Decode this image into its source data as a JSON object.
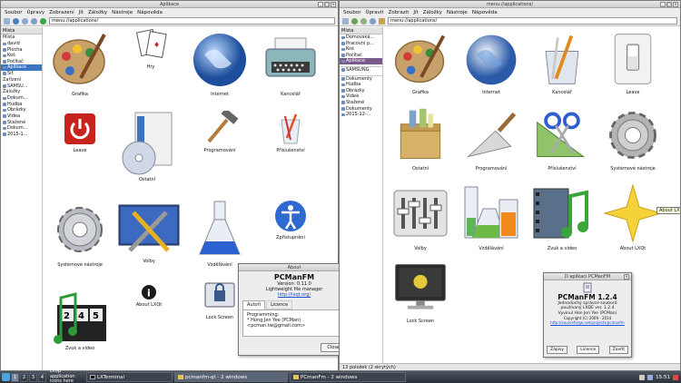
{
  "left_window": {
    "title": "Aplikace",
    "menu": [
      "Soubor",
      "Úpravy",
      "Zobrazení",
      "Jít",
      "Záložky",
      "Nástroje",
      "Nápověda"
    ],
    "address": "menu://applications/",
    "sidebar": {
      "header": "Místa",
      "group_places": "Místa",
      "places": [
        "david",
        "Plocha",
        "Koš",
        "Počítač",
        "Aplikace",
        "Síť"
      ],
      "group_devices": "Zařízení",
      "devices": [
        "SAMSU..."
      ],
      "group_bookmarks": "Záložky",
      "bookmarks": [
        "Dokum...",
        "Hudba",
        "Obrázky",
        "Videa",
        "Stažené",
        "Dokum...",
        "2015-1..."
      ]
    },
    "icons": [
      "Grafika",
      "Hry",
      "Internet",
      "Kancelář",
      "Leave",
      "Ostatní",
      "Programování",
      "Příslušenství",
      "Systémové nástroje",
      "Volby",
      "Vzdělávání",
      "Zpřístupnění",
      "Zvuk a video",
      "About LXQt",
      "Lock Screen"
    ]
  },
  "right_window": {
    "title": "menu://applications/",
    "menu": [
      "Soubor",
      "Úpravit",
      "Zobrazit",
      "Jít",
      "Záložky",
      "Nástroje",
      "Nápověda"
    ],
    "address": "menu://applications/",
    "sidebar": {
      "header": "Místa",
      "items": [
        "Domovská...",
        "Pracovní p...",
        "Koš",
        "Počítač",
        "Aplikace",
        "SAMSUNG",
        "Dokumenty",
        "Hudba",
        "Obrázky",
        "Videa",
        "Stažené",
        "Dokumenty",
        "2015-12-..."
      ]
    },
    "icons": [
      "Grafika",
      "Internet",
      "Kancelář",
      "Leave",
      "Ostatní",
      "Programování",
      "Příslušenství",
      "Systémové nástroje",
      "Volby",
      "Vzdělávání",
      "Zvuk a video",
      "About LXQt",
      "Lock Screen"
    ],
    "tooltip": "About LXQt",
    "status": "13 položek (2 skrytých)"
  },
  "about_left": {
    "title": "About",
    "app_name": "PCManFM",
    "version": "Version: 0.11.0",
    "desc": "Lightweight file manager",
    "link": "http://lxqt.org/",
    "tabs": [
      "Autoři",
      "Licence"
    ],
    "content_heading": "Programming:",
    "content_line1": "* Hong Jen Yee (PCMan)",
    "content_line2": "<pcman.tw@gmail.com>",
    "close_label": "Close"
  },
  "about_right": {
    "title": "O aplikaci PCManFM",
    "app_name": "PCManFM 1.2.4",
    "desc1": "Jednoduchý správce souborů",
    "desc2": "používaný LXDE ver. 1.2.4",
    "author": "Vyvinul Hon Jen Yee (PCMan)",
    "copyright": "Copyright (C) 2009 - 2014",
    "link": "http://sourceforge.net/projects/pcmanfm",
    "btn_credits": "Zápisy",
    "btn_license": "Licence",
    "btn_close": "Zavřít"
  },
  "taskbar": {
    "workspaces": [
      "1",
      "2",
      "3",
      "4"
    ],
    "items": [
      "Drop application icons here",
      "LXTerminal",
      "pcmanfm-qt - 2 windows",
      "PCmanFm - 2 windows"
    ],
    "clock": "15:51"
  }
}
